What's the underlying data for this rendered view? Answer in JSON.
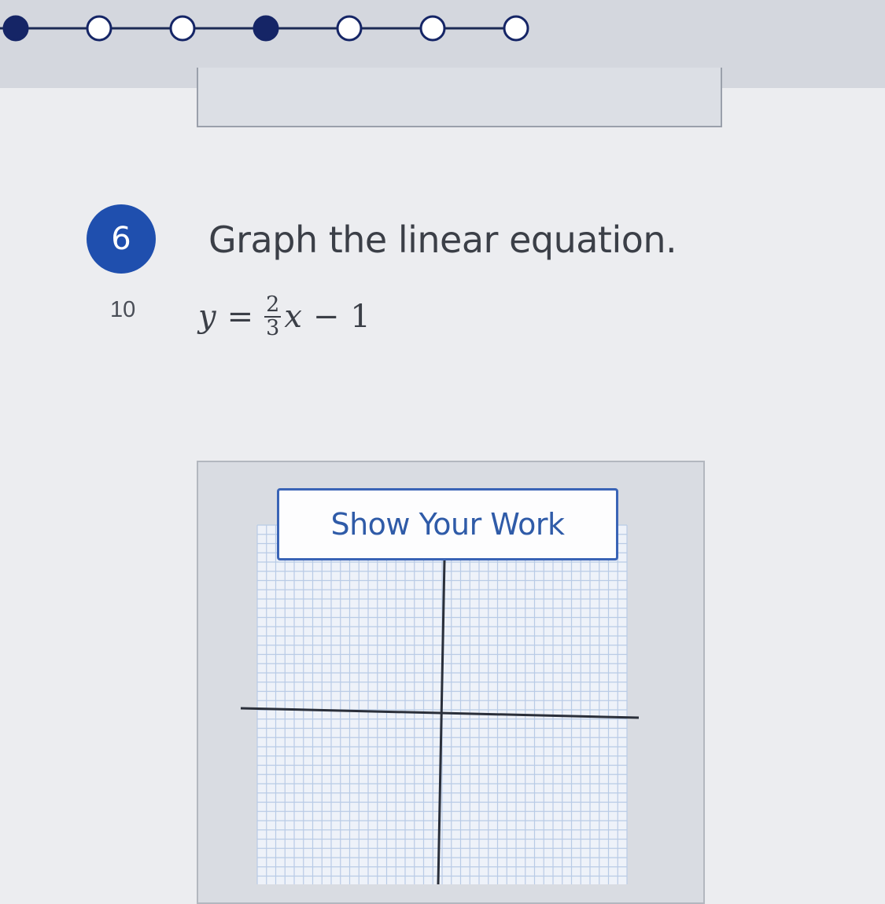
{
  "question": {
    "number": "6",
    "prompt": "Graph the linear equation.",
    "points": "10",
    "equation": {
      "lhs": "y",
      "equals": "=",
      "frac_num": "2",
      "frac_den": "3",
      "variable": "x",
      "minus": "−",
      "constant": "1"
    }
  },
  "work_area": {
    "button_label": "Show Your Work"
  },
  "progress": {
    "steps": [
      {
        "filled": true
      },
      {
        "filled": false
      },
      {
        "filled": false
      },
      {
        "filled": true
      },
      {
        "filled": false
      },
      {
        "filled": false
      },
      {
        "filled": false
      }
    ]
  },
  "colors": {
    "accent": "#1f4fae",
    "button_text": "#2f5ba8",
    "grid_line": "#b9cbe6"
  }
}
